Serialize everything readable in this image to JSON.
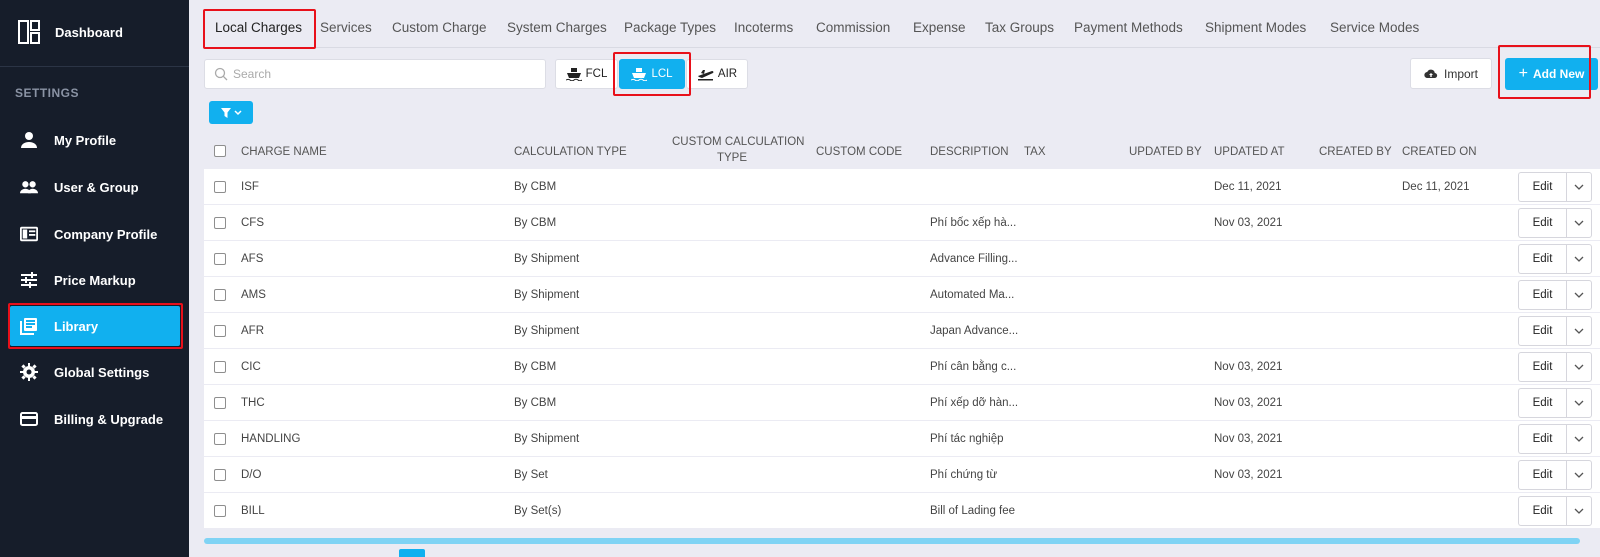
{
  "sidebar": {
    "dashboard_label": "Dashboard",
    "section_heading": "SETTINGS",
    "items": [
      {
        "label": "My Profile",
        "icon": "person-icon"
      },
      {
        "label": "User & Group",
        "icon": "users-icon"
      },
      {
        "label": "Company Profile",
        "icon": "id-card-icon"
      },
      {
        "label": "Price Markup",
        "icon": "sliders-icon"
      },
      {
        "label": "Library",
        "icon": "library-icon",
        "active": true
      },
      {
        "label": "Global Settings",
        "icon": "gear-icon"
      },
      {
        "label": "Billing & Upgrade",
        "icon": "credit-card-icon"
      }
    ]
  },
  "tabs": [
    "Local Charges",
    "Services",
    "Custom Charge",
    "System Charges",
    "Package Types",
    "Incoterms",
    "Commission",
    "Expense",
    "Tax Groups",
    "Payment Methods",
    "Shipment Modes",
    "Service Modes"
  ],
  "active_tab": "Local Charges",
  "toolbar": {
    "search_placeholder": "Search",
    "search_value": "",
    "modes": [
      {
        "label": "FCL",
        "icon": "ship-icon"
      },
      {
        "label": "LCL",
        "icon": "ship-icon",
        "active": true
      },
      {
        "label": "AIR",
        "icon": "plane-icon"
      }
    ],
    "import_label": "Import",
    "add_new_label": "Add New"
  },
  "table": {
    "columns": {
      "charge_name": "CHARGE NAME",
      "calculation_type": "CALCULATION TYPE",
      "custom_calc_line1": "CUSTOM CALCULATION",
      "custom_calc_line2": "TYPE",
      "custom_code": "CUSTOM CODE",
      "description": "DESCRIPTION",
      "tax": "TAX",
      "updated_by": "UPDATED BY",
      "updated_at": "UPDATED AT",
      "created_by": "CREATED BY",
      "created_on": "CREATED ON"
    },
    "edit_label": "Edit",
    "rows": [
      {
        "name": "ISF",
        "calc": "By CBM",
        "desc": "",
        "updated_at": "Dec 11, 2021",
        "created_on": "Dec 11, 2021"
      },
      {
        "name": "CFS",
        "calc": "By CBM",
        "desc": "Phí bốc xếp hà...",
        "updated_at": "Nov 03, 2021",
        "created_on": ""
      },
      {
        "name": "AFS",
        "calc": "By Shipment",
        "desc": "Advance Filling...",
        "updated_at": "",
        "created_on": ""
      },
      {
        "name": "AMS",
        "calc": "By Shipment",
        "desc": "Automated Ma...",
        "updated_at": "",
        "created_on": ""
      },
      {
        "name": "AFR",
        "calc": "By Shipment",
        "desc": "Japan Advance...",
        "updated_at": "",
        "created_on": ""
      },
      {
        "name": "CIC",
        "calc": "By CBM",
        "desc": "Phí cân bằng c...",
        "updated_at": "Nov 03, 2021",
        "created_on": ""
      },
      {
        "name": "THC",
        "calc": "By CBM",
        "desc": "Phí xếp dỡ hàn...",
        "updated_at": "Nov 03, 2021",
        "created_on": ""
      },
      {
        "name": "HANDLING",
        "calc": "By Shipment",
        "desc": "Phí tác nghiệp",
        "updated_at": "Nov 03, 2021",
        "created_on": ""
      },
      {
        "name": "D/O",
        "calc": "By Set",
        "desc": "Phí chứng từ",
        "updated_at": "Nov 03, 2021",
        "created_on": ""
      },
      {
        "name": "BILL",
        "calc": "By Set(s)",
        "desc": "Bill of Lading fee",
        "updated_at": "",
        "created_on": ""
      }
    ]
  },
  "colors": {
    "accent": "#11b0ef",
    "sidebar_bg": "#161d2a",
    "highlight": "#e8101a",
    "page_bg": "#ebebf3"
  }
}
